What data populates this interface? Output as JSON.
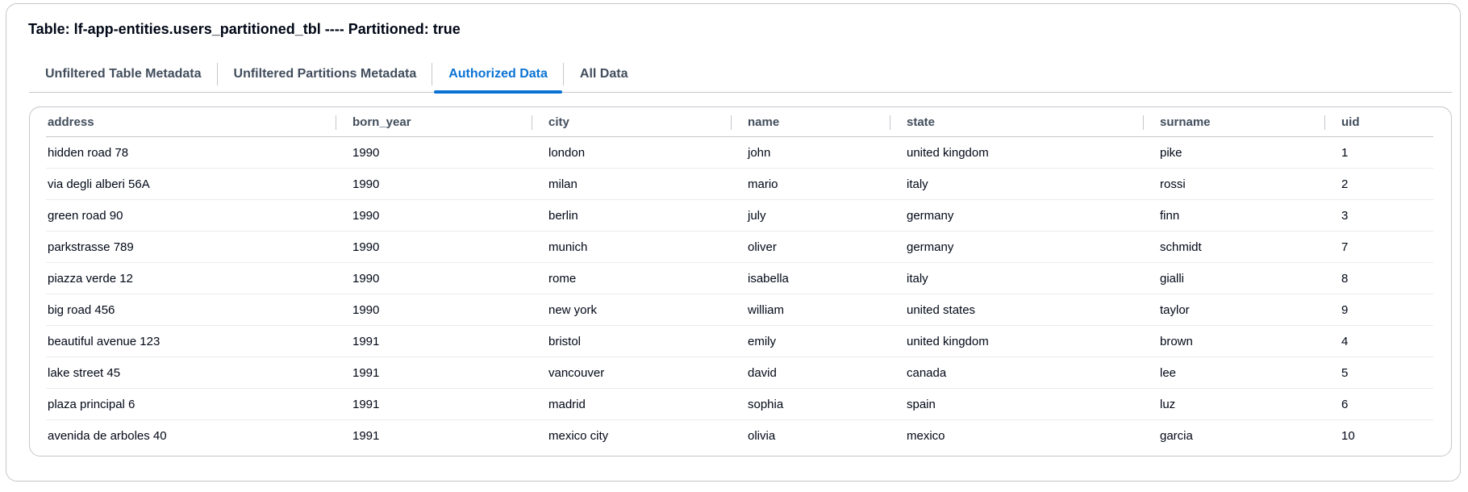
{
  "title": "Table: lf-app-entities.users_partitioned_tbl ---- Partitioned: true",
  "tabs": [
    {
      "label": "Unfiltered Table Metadata",
      "active": false
    },
    {
      "label": "Unfiltered Partitions Metadata",
      "active": false
    },
    {
      "label": "Authorized Data",
      "active": true
    },
    {
      "label": "All Data",
      "active": false
    }
  ],
  "table": {
    "columns": [
      "address",
      "born_year",
      "city",
      "name",
      "state",
      "surname",
      "uid"
    ],
    "rows": [
      [
        "hidden road 78",
        "1990",
        "london",
        "john",
        "united kingdom",
        "pike",
        "1"
      ],
      [
        "via degli alberi 56A",
        "1990",
        "milan",
        "mario",
        "italy",
        "rossi",
        "2"
      ],
      [
        "green road 90",
        "1990",
        "berlin",
        "july",
        "germany",
        "finn",
        "3"
      ],
      [
        "parkstrasse 789",
        "1990",
        "munich",
        "oliver",
        "germany",
        "schmidt",
        "7"
      ],
      [
        "piazza verde 12",
        "1990",
        "rome",
        "isabella",
        "italy",
        "gialli",
        "8"
      ],
      [
        "big road 456",
        "1990",
        "new york",
        "william",
        "united states",
        "taylor",
        "9"
      ],
      [
        "beautiful avenue 123",
        "1991",
        "bristol",
        "emily",
        "united kingdom",
        "brown",
        "4"
      ],
      [
        "lake street 45",
        "1991",
        "vancouver",
        "david",
        "canada",
        "lee",
        "5"
      ],
      [
        "plaza principal 6",
        "1991",
        "madrid",
        "sophia",
        "spain",
        "luz",
        "6"
      ],
      [
        "avenida de arboles 40",
        "1991",
        "mexico city",
        "olivia",
        "mexico",
        "garcia",
        "10"
      ]
    ]
  },
  "colors": {
    "accent": "#0972d3",
    "text": "#000716",
    "muted": "#414d5c",
    "border": "#c6c6cd"
  }
}
